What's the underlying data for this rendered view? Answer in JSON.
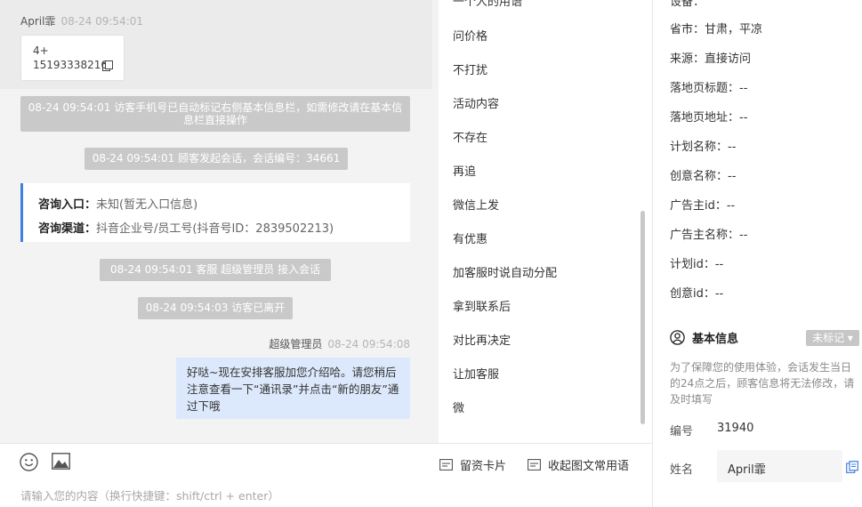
{
  "chat": {
    "customer_name": "April霏",
    "customer_time": "08-24 09:54:01",
    "phone_card": {
      "line1": "4+",
      "line2": "15193338216"
    },
    "sys_msgs": [
      "08-24 09:54:01 访客手机号已自动标记右侧基本信息栏，如需修改请在基本信息栏直接操作",
      "08-24 09:54:01 顾客发起会话，会话编号：34661",
      "08-24 09:54:01 客服 超级管理员 接入会话",
      "08-24 09:54:03 访客已离开"
    ],
    "entry": {
      "entry_label": "咨询入口：",
      "entry_value": "未知(暂无入口信息)",
      "channel_label": "咨询渠道：",
      "channel_value": "抖音企业号/员工号(抖音号ID：2839502213)"
    },
    "agent_name": "超级管理员",
    "agent_time": "08-24 09:54:08",
    "agent_msg": "好哒~现在安排客服加您介绍哈。请您稍后注意查看一下“通讯录”并点击“新的朋友”通过下哦"
  },
  "quick_replies": [
    "一个人的用语",
    "问价格",
    "不打扰",
    "活动内容",
    "不存在",
    "再追",
    "微信上发",
    "有优惠",
    "加客服时说自动分配",
    "拿到联系后",
    "对比再决定",
    "让加客服",
    "微"
  ],
  "input": {
    "card_label": "留资卡片",
    "phrase_label": "收起图文常用语",
    "placeholder": "请输入您的内容（换行快捷键：shift/ctrl + enter）"
  },
  "info": {
    "top_cut": "设备：",
    "rows": [
      "省市：甘肃，平凉",
      "来源：直接访问",
      "落地页标题：--",
      "落地页地址：--",
      "计划名称：--",
      "创意名称：--",
      "广告主id：--",
      "广告主名称：--",
      "计划id：--",
      "创意id：--"
    ],
    "basic_title": "基本信息",
    "unmarked": "未标记",
    "note": "为了保障您的使用体验，会话发生当日的24点之后，顾客信息将无法修改，请及时填写",
    "id_label": "编号",
    "id_value": "31940",
    "name_label": "姓名",
    "name_value": "April霏"
  },
  "colors": {
    "accent": "#3f7fe0",
    "agent_bubble": "#dce8fb",
    "system_msg": "#c9c9c9"
  }
}
